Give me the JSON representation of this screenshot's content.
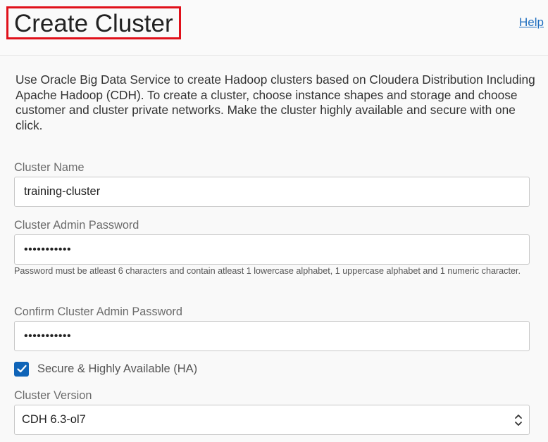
{
  "header": {
    "title": "Create Cluster",
    "help_label": "Help"
  },
  "intro": "Use Oracle Big Data Service to create Hadoop clusters based on Cloudera Distribution Including Apache Hadoop (CDH). To create a cluster, choose instance shapes and storage and choose customer and cluster private networks. Make the cluster highly available and secure with one click.",
  "form": {
    "cluster_name": {
      "label": "Cluster Name",
      "value": "training-cluster"
    },
    "admin_password": {
      "label": "Cluster Admin Password",
      "value": "•••••••••••",
      "hint": "Password must be atleast 6 characters and contain atleast 1 lowercase alphabet, 1 uppercase alphabet and 1 numeric character."
    },
    "confirm_password": {
      "label": "Confirm Cluster Admin Password",
      "value": "•••••••••••"
    },
    "secure_ha": {
      "label": "Secure & Highly Available (HA)",
      "checked": true
    },
    "cluster_version": {
      "label": "Cluster Version",
      "selected": "CDH 6.3-ol7"
    }
  },
  "colors": {
    "highlight_border": "#e0101a",
    "link": "#1f6ebf",
    "checkbox": "#0f64b8"
  },
  "icons": {
    "checkbox": "checkmark-icon",
    "select": "chevron-up-down-icon"
  }
}
